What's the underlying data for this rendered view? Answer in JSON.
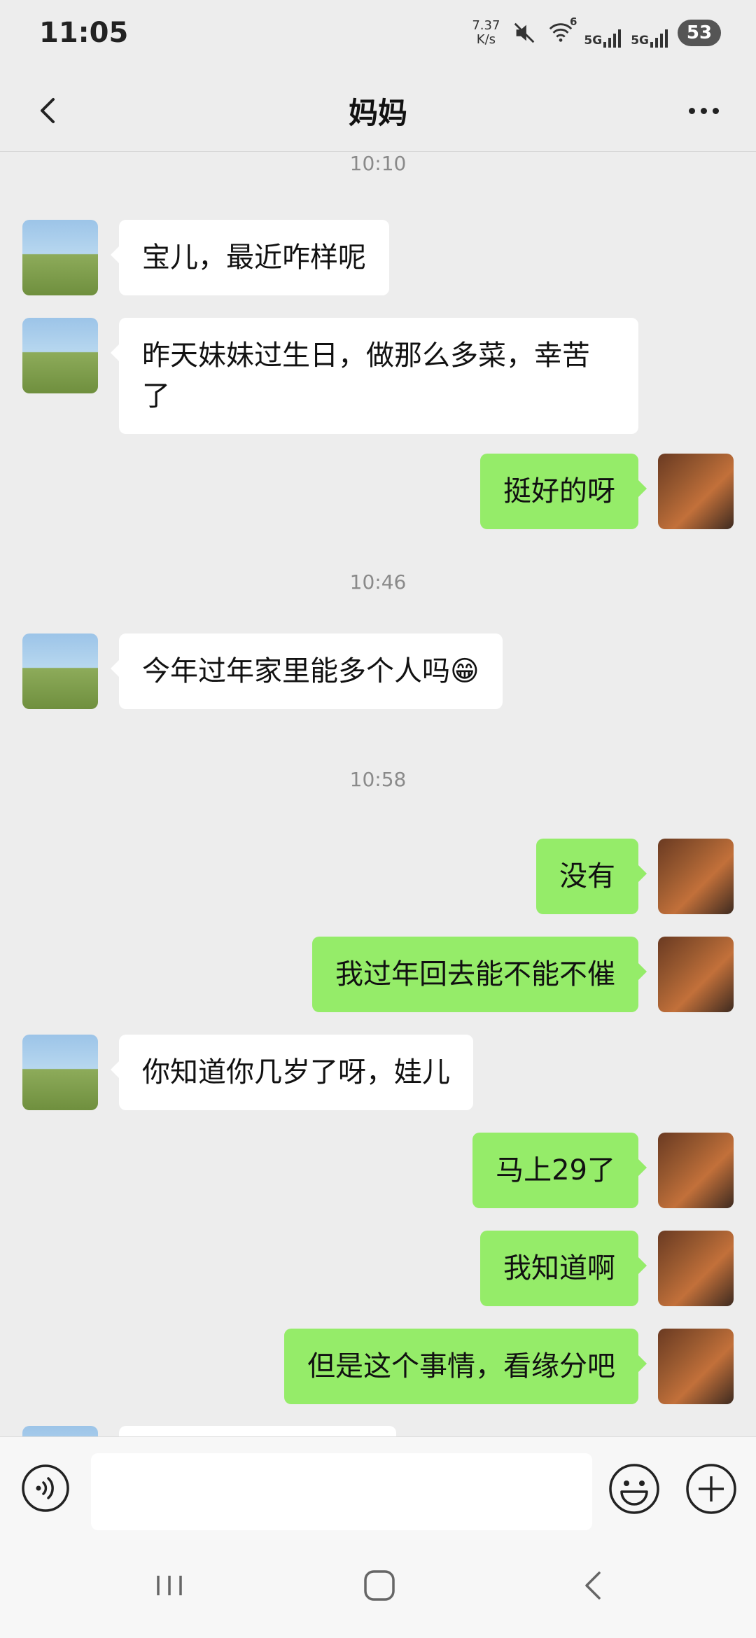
{
  "status_bar": {
    "time": "11:05",
    "net_speed_value": "7.37",
    "net_speed_unit": "K/s",
    "signal_1": "5G",
    "signal_2": "5G",
    "wifi_label": "6",
    "battery": "53"
  },
  "header": {
    "title": "妈妈"
  },
  "chat": {
    "times": [
      "10:10",
      "10:46",
      "10:58"
    ],
    "messages": [
      {
        "side": "in",
        "text": "宝儿，最近咋样呢"
      },
      {
        "side": "in",
        "text": "昨天妹妹过生日，做那么多菜，幸苦了"
      },
      {
        "side": "out",
        "text": "挺好的呀"
      },
      {
        "side": "in",
        "text": "今年过年家里能多个人吗😁"
      },
      {
        "side": "out",
        "text": "没有"
      },
      {
        "side": "out",
        "text": "我过年回去能不能不催"
      },
      {
        "side": "in",
        "text": "你知道你几岁了呀，娃儿"
      },
      {
        "side": "out",
        "text": "马上29了"
      },
      {
        "side": "out",
        "text": "我知道啊"
      },
      {
        "side": "out",
        "text": "但是这个事情，看缘分吧"
      }
    ]
  },
  "input_bar": {
    "placeholder": ""
  },
  "colors": {
    "background": "#EDEDED",
    "outgoing_bubble": "#95EC69",
    "incoming_bubble": "#FFFFFF"
  },
  "icons": [
    "back-icon",
    "more-icon",
    "voice-icon",
    "emoji-icon",
    "plus-icon",
    "recents-icon",
    "home-icon",
    "nav-back-icon"
  ]
}
